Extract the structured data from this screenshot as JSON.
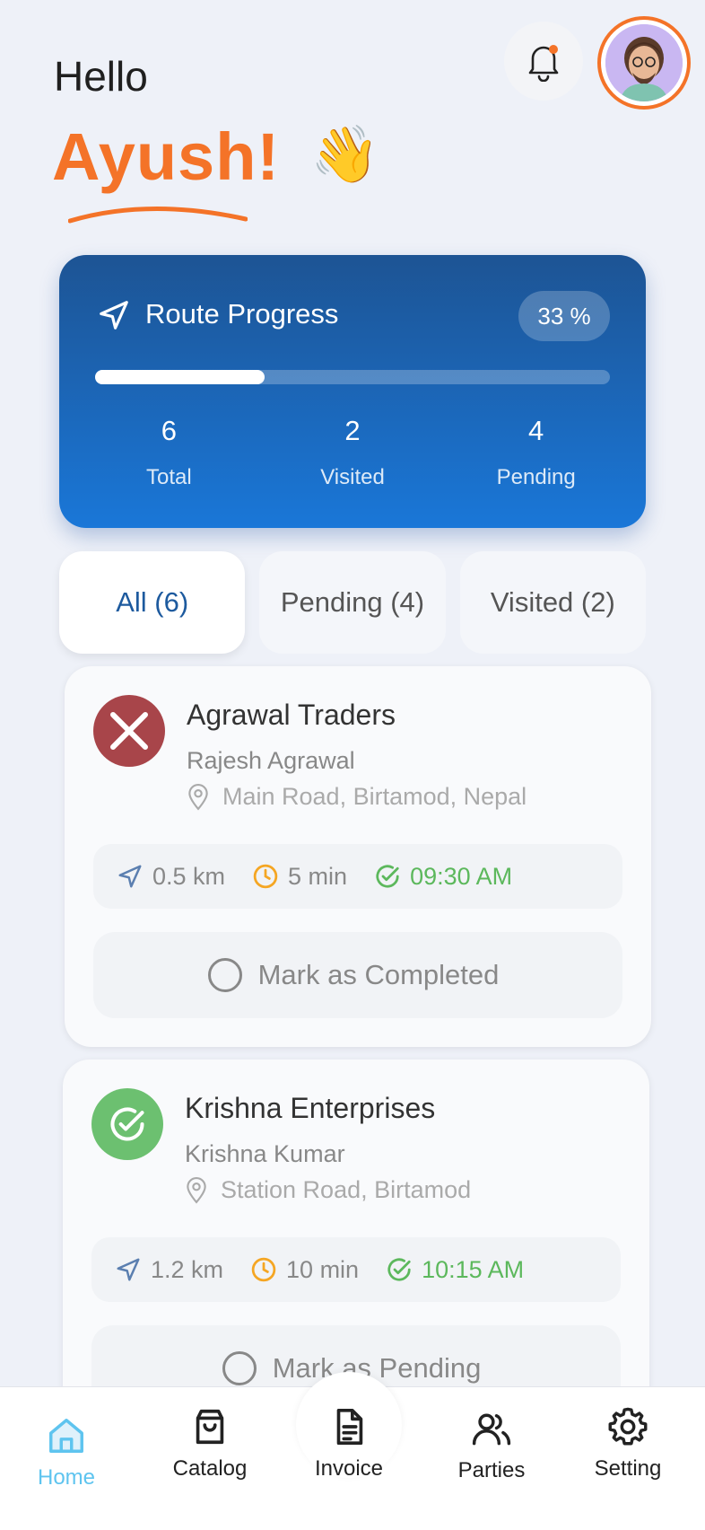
{
  "header": {
    "greeting": "Hello",
    "name": "Ayush!",
    "wave_emoji": "👋",
    "bell_icon": "bell-icon",
    "avatar_icon": "avatar"
  },
  "route_progress": {
    "title": "Route Progress",
    "percent_label": "33 %",
    "progress_fraction": 0.33,
    "stats": [
      {
        "value": "6",
        "label": "Total"
      },
      {
        "value": "2",
        "label": "Visited"
      },
      {
        "value": "4",
        "label": "Pending"
      }
    ]
  },
  "tabs": [
    {
      "label": "All (6)",
      "active": true
    },
    {
      "label": "Pending (4)",
      "active": false
    },
    {
      "label": "Visited (2)",
      "active": false
    }
  ],
  "stops": [
    {
      "name": "Agrawal Traders",
      "person": "Rajesh Agrawal",
      "address": "Main Road, Birtamod, Nepal",
      "distance": "0.5 km",
      "duration": "5 min",
      "time": "09:30 AM",
      "action": "Mark as Completed",
      "status": "pending",
      "status_color": "#a8454a"
    },
    {
      "name": "Krishna Enterprises",
      "person": "Krishna Kumar",
      "address": "Station Road, Birtamod",
      "distance": "1.2 km",
      "duration": "10 min",
      "time": "10:15 AM",
      "action": "Mark as Pending",
      "status": "visited",
      "status_color": "#6cc070"
    }
  ],
  "bottom_nav": [
    {
      "label": "Home",
      "icon": "home-icon",
      "active": true
    },
    {
      "label": "Catalog",
      "icon": "bag-icon",
      "active": false
    },
    {
      "label": "Invoice",
      "icon": "document-icon",
      "active": false
    },
    {
      "label": "Parties",
      "icon": "users-icon",
      "active": false
    },
    {
      "label": "Setting",
      "icon": "gear-icon",
      "active": false
    }
  ],
  "colors": {
    "accent": "#f47328",
    "primary": "#1d5a9e",
    "nav_active": "#5ec4ef",
    "success": "#5cb85c",
    "warning": "#f5a623"
  }
}
